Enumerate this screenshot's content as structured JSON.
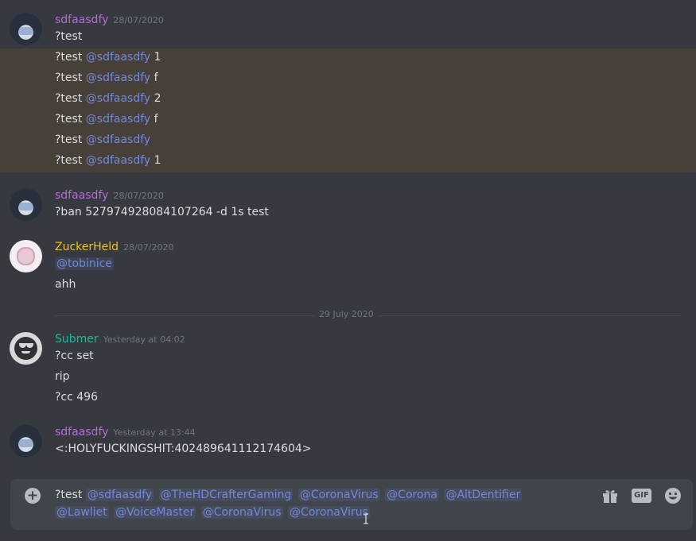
{
  "colors": {
    "bg": "#36393f",
    "mention": "#7289da",
    "timestamp": "#72767d"
  },
  "messages": [
    {
      "author": "sdfaasdfy",
      "author_color": "#b96ad9",
      "timestamp": "28/07/2020",
      "avatar": "hooded-avatar",
      "lines": [
        {
          "text": "?test",
          "mention": "",
          "suffix": ""
        },
        {
          "text": "?test ",
          "mention": "@sdfaasdfy",
          "suffix": " 1"
        },
        {
          "text": "?test ",
          "mention": "@sdfaasdfy",
          "suffix": " f"
        },
        {
          "text": "?test ",
          "mention": "@sdfaasdfy",
          "suffix": " 2"
        },
        {
          "text": "?test ",
          "mention": "@sdfaasdfy",
          "suffix": " f"
        },
        {
          "text": "?test ",
          "mention": "@sdfaasdfy",
          "suffix": ""
        },
        {
          "text": "?test ",
          "mention": "@sdfaasdfy",
          "suffix": " 1"
        }
      ]
    },
    {
      "author": "sdfaasdfy",
      "author_color": "#b96ad9",
      "timestamp": "28/07/2020",
      "avatar": "hooded-avatar",
      "lines": [
        {
          "text": "?ban 527974928084107264 -d 1s test"
        }
      ]
    },
    {
      "author": "ZuckerHeld",
      "author_color": "#f1c40f",
      "timestamp": "28/07/2020",
      "avatar": "pink-avatar",
      "lines": [
        {
          "mention": "@tobinice"
        },
        {
          "text": "ahh"
        }
      ]
    },
    {
      "author": "Submer",
      "author_color": "#1abc9c",
      "timestamp": "Yesterday at 04:02",
      "avatar": "sunglasses-avatar",
      "lines": [
        {
          "text": "?cc set"
        },
        {
          "text": "rip"
        },
        {
          "text": "?cc 496"
        }
      ]
    },
    {
      "author": "sdfaasdfy",
      "author_color": "#b96ad9",
      "timestamp": "Yesterday at 13:44",
      "avatar": "hooded-avatar",
      "lines": [
        {
          "text": "<:HOLYFUCKINGSHIT:402489641112174604>"
        }
      ]
    }
  ],
  "divider": {
    "label": "29 July 2020"
  },
  "composer": {
    "prefix": "?test ",
    "mentions": [
      "@sdfaasdfy",
      "@TheHDCrafterGaming",
      "@CoronaVirus",
      "@Corona",
      "@AltDentifier",
      "@Lawliet",
      "@VoiceMaster",
      "@CoronaVirus",
      "@CoronaVirus"
    ],
    "attach_icon": "plus-circle-icon",
    "gift_icon": "gift-icon",
    "gif_label": "GIF",
    "emoji_icon": "smile-emoji-icon"
  }
}
